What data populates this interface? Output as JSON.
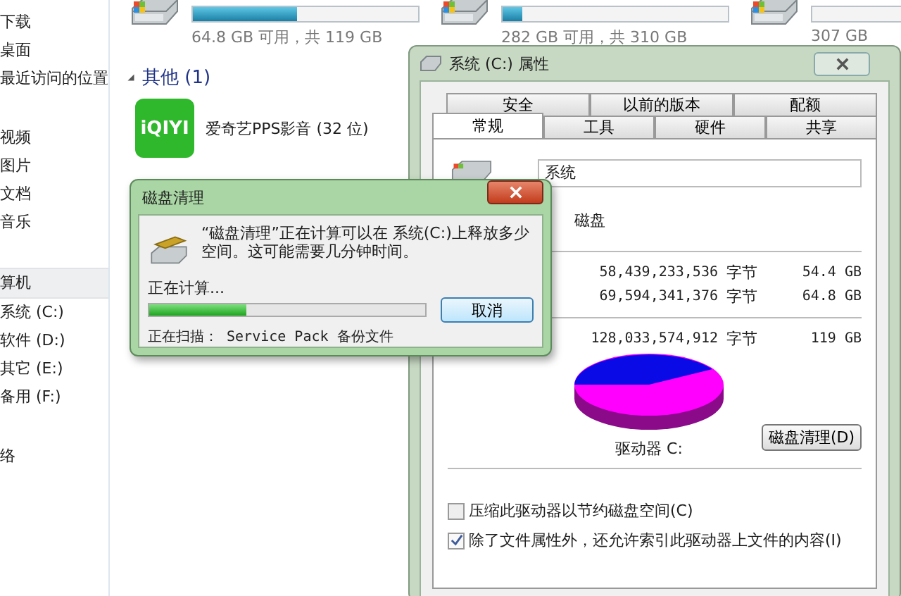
{
  "sidebar": {
    "sections": [
      {
        "items": [
          {
            "label": "下载",
            "selected": false
          },
          {
            "label": "桌面",
            "selected": false
          },
          {
            "label": "最近访问的位置",
            "selected": false
          }
        ]
      },
      {
        "items": [
          {
            "label": "视频",
            "selected": false
          },
          {
            "label": "图片",
            "selected": false
          },
          {
            "label": "文档",
            "selected": false
          },
          {
            "label": "音乐",
            "selected": false
          }
        ]
      },
      {
        "items": [
          {
            "label": "算机",
            "selected": true
          },
          {
            "label": "系统 (C:)",
            "selected": false
          },
          {
            "label": "软件 (D:)",
            "selected": false
          },
          {
            "label": "其它 (E:)",
            "selected": false
          },
          {
            "label": "备用 (F:)",
            "selected": false
          }
        ]
      },
      {
        "items": [
          {
            "label": "络",
            "selected": false
          }
        ]
      }
    ]
  },
  "drives": [
    {
      "free_text": "64.8 GB 可用，共 119 GB",
      "level": 0.46
    },
    {
      "free_text": "282 GB 可用，共 310 GB",
      "level": 0.09
    },
    {
      "free_text": "307 GB"
    }
  ],
  "group": {
    "title": "其他 (1)",
    "expanded": true,
    "items": [
      {
        "label": "爱奇艺PPS影音 (32 位)",
        "logo": "iQIYI"
      }
    ]
  },
  "properties": {
    "title": "系统 (C:) 属性",
    "tabs_row1": [
      {
        "label": "安全",
        "selected": false
      },
      {
        "label": "以前的版本",
        "selected": false
      },
      {
        "label": "配额",
        "selected": false
      }
    ],
    "tabs_row2": [
      {
        "label": "常规",
        "selected": true
      },
      {
        "label": "工具",
        "selected": false
      },
      {
        "label": "硬件",
        "selected": false
      },
      {
        "label": "共享",
        "selected": false
      }
    ],
    "name_value": "系统",
    "type_text": "磁盘",
    "rows": [
      {
        "bytes": "58,439,233,536",
        "unit": "字节",
        "size": "54.4 GB"
      },
      {
        "bytes": "69,594,341,376",
        "unit": "字节",
        "size": "64.8 GB"
      }
    ],
    "total": {
      "bytes": "128,033,574,912",
      "unit": "字节",
      "size": "119 GB"
    },
    "drive_label": "驱动器 C:",
    "cleanup_button": "磁盘清理(D)",
    "options": [
      {
        "label": "压缩此驱动器以节约磁盘空间(C)",
        "checked": false
      },
      {
        "label": "除了文件属性外，还允许索引此驱动器上文件的内容(I)",
        "checked": true
      }
    ]
  },
  "cleanup": {
    "title": "磁盘清理",
    "message": "“磁盘清理”正在计算可以在 系统(C:)上释放多少空间。这可能需要几分钟时间。",
    "status": "正在计算...",
    "level": 0.35,
    "cancel": "取消",
    "scanning": "正在扫描： Service Pack 备份文件"
  }
}
